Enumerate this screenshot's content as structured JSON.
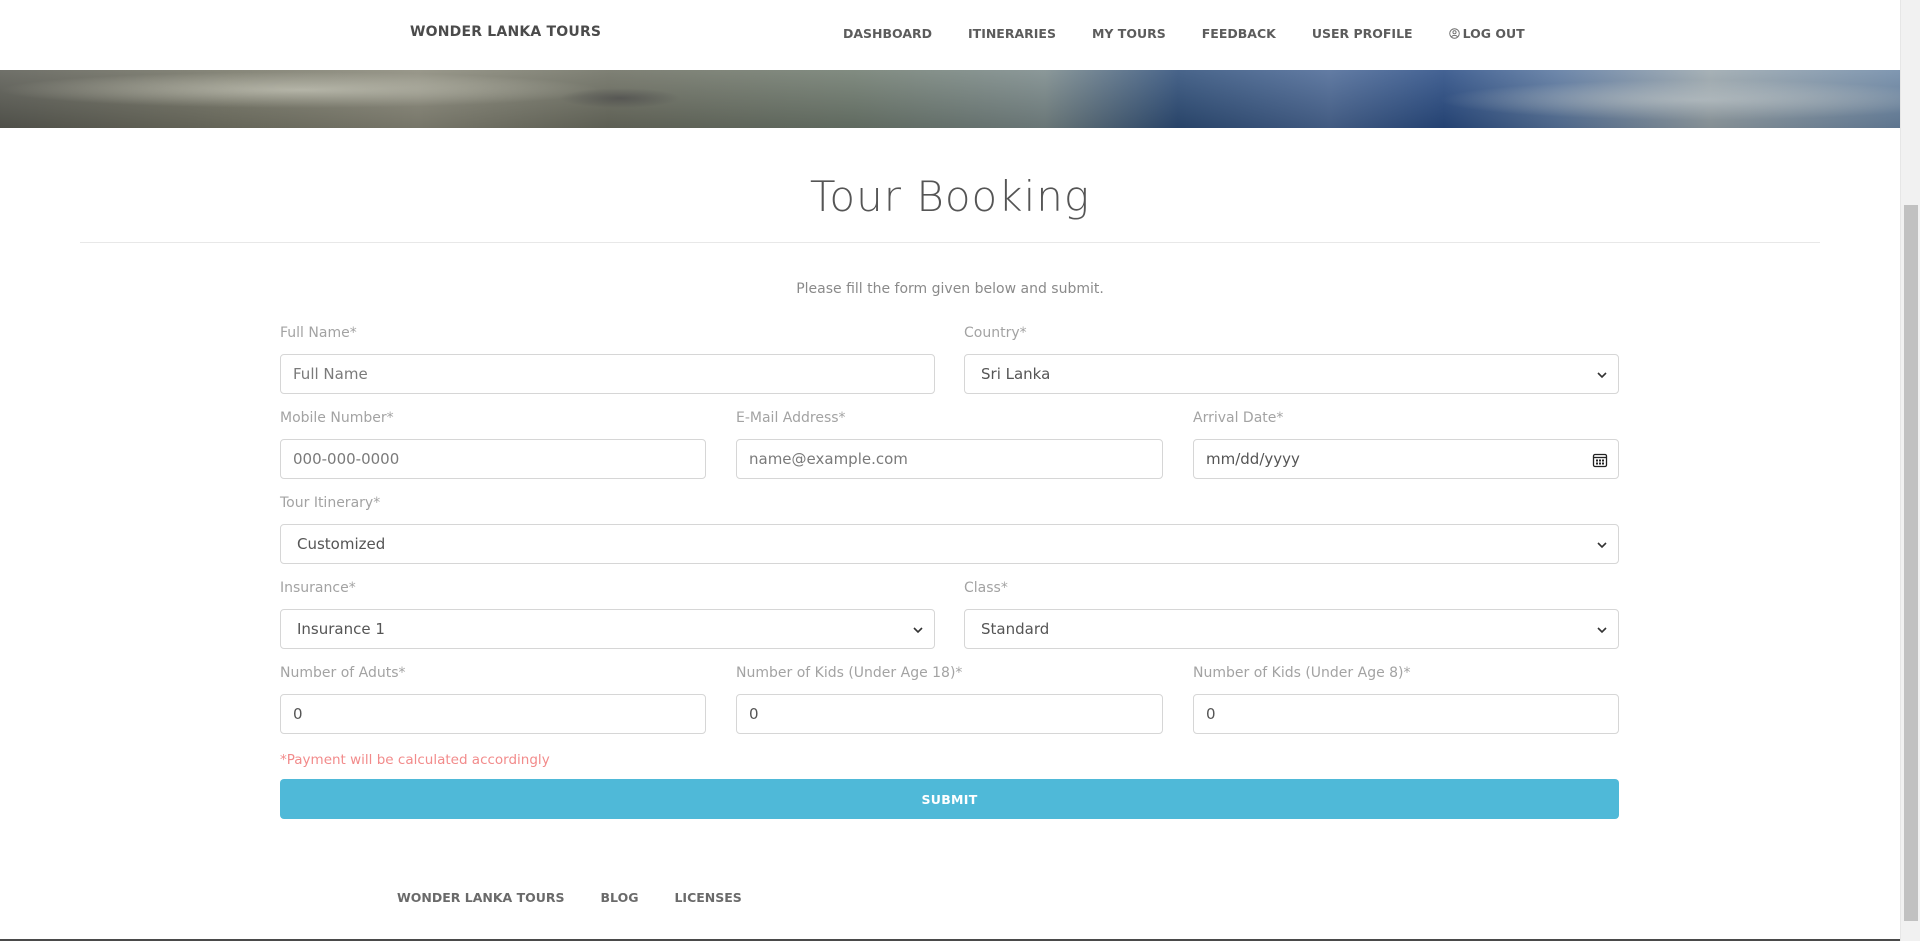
{
  "nav": {
    "brand": "WONDER LANKA TOURS",
    "links": [
      {
        "label": "DASHBOARD"
      },
      {
        "label": "ITINERARIES"
      },
      {
        "label": "MY TOURS"
      },
      {
        "label": "FEEDBACK"
      },
      {
        "label": "USER PROFILE"
      },
      {
        "label": "LOG OUT",
        "icon": "user-circle-icon"
      }
    ]
  },
  "page": {
    "title": "Tour Booking",
    "intro": "Please fill the form given below and submit."
  },
  "form": {
    "full_name": {
      "label": "Full Name*",
      "placeholder": "Full Name"
    },
    "country": {
      "label": "Country*",
      "value": "Sri Lanka"
    },
    "mobile": {
      "label": "Mobile Number*",
      "placeholder": "000-000-0000"
    },
    "email": {
      "label": "E-Mail Address*",
      "placeholder": "name@example.com"
    },
    "arrival": {
      "label": "Arrival Date*",
      "placeholder": "mm/dd/yyyy",
      "icon": "calendar-icon"
    },
    "itinerary": {
      "label": "Tour Itinerary*",
      "value": "Customized"
    },
    "insurance": {
      "label": "Insurance*",
      "value": "Insurance 1"
    },
    "class": {
      "label": "Class*",
      "value": "Standard"
    },
    "adults": {
      "label": "Number of Aduts*",
      "value": "0"
    },
    "kids18": {
      "label": "Number of Kids (Under Age 18)*",
      "value": "0"
    },
    "kids8": {
      "label": "Number of Kids (Under Age 8)*",
      "value": "0"
    },
    "note": "*Payment will be calculated accordingly",
    "submit_label": "SUBMIT"
  },
  "footer": {
    "links": [
      {
        "label": "WONDER LANKA TOURS"
      },
      {
        "label": "BLOG"
      },
      {
        "label": "LICENSES"
      }
    ]
  },
  "colors": {
    "accent": "#4fb9d8",
    "note": "#f28b8b"
  }
}
